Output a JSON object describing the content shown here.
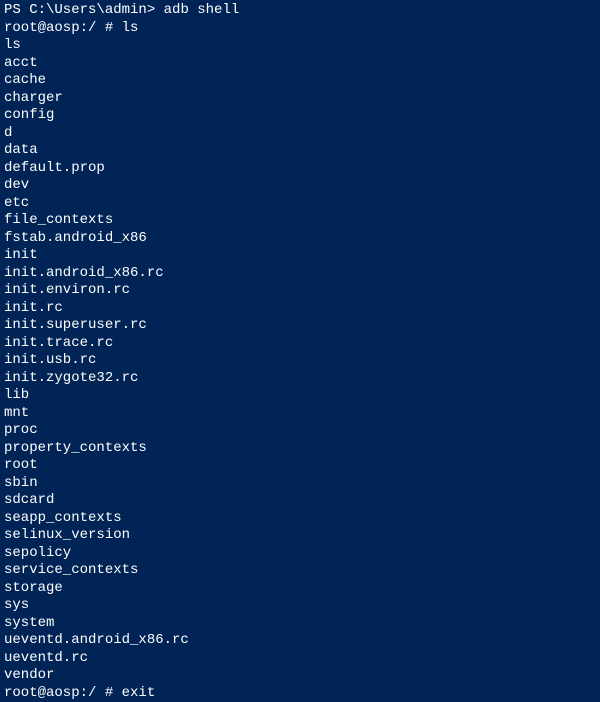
{
  "lines": [
    {
      "type": "prompt-cmd",
      "prompt": "PS C:\\Users\\admin> ",
      "cmd": "adb shell"
    },
    {
      "type": "prompt-cmd",
      "prompt": "root@aosp:/ # ",
      "cmd": "ls"
    },
    {
      "type": "output",
      "text": "ls"
    },
    {
      "type": "output",
      "text": "acct"
    },
    {
      "type": "output",
      "text": "cache"
    },
    {
      "type": "output",
      "text": "charger"
    },
    {
      "type": "output",
      "text": "config"
    },
    {
      "type": "output",
      "text": "d"
    },
    {
      "type": "output",
      "text": "data"
    },
    {
      "type": "output",
      "text": "default.prop"
    },
    {
      "type": "output",
      "text": "dev"
    },
    {
      "type": "output",
      "text": "etc"
    },
    {
      "type": "output",
      "text": "file_contexts"
    },
    {
      "type": "output",
      "text": "fstab.android_x86"
    },
    {
      "type": "output",
      "text": "init"
    },
    {
      "type": "output",
      "text": "init.android_x86.rc"
    },
    {
      "type": "output",
      "text": "init.environ.rc"
    },
    {
      "type": "output",
      "text": "init.rc"
    },
    {
      "type": "output",
      "text": "init.superuser.rc"
    },
    {
      "type": "output",
      "text": "init.trace.rc"
    },
    {
      "type": "output",
      "text": "init.usb.rc"
    },
    {
      "type": "output",
      "text": "init.zygote32.rc"
    },
    {
      "type": "output",
      "text": "lib"
    },
    {
      "type": "output",
      "text": "mnt"
    },
    {
      "type": "output",
      "text": "proc"
    },
    {
      "type": "output",
      "text": "property_contexts"
    },
    {
      "type": "output",
      "text": "root"
    },
    {
      "type": "output",
      "text": "sbin"
    },
    {
      "type": "output",
      "text": "sdcard"
    },
    {
      "type": "output",
      "text": "seapp_contexts"
    },
    {
      "type": "output",
      "text": "selinux_version"
    },
    {
      "type": "output",
      "text": "sepolicy"
    },
    {
      "type": "output",
      "text": "service_contexts"
    },
    {
      "type": "output",
      "text": "storage"
    },
    {
      "type": "output",
      "text": "sys"
    },
    {
      "type": "output",
      "text": "system"
    },
    {
      "type": "output",
      "text": "ueventd.android_x86.rc"
    },
    {
      "type": "output",
      "text": "ueventd.rc"
    },
    {
      "type": "output",
      "text": "vendor"
    },
    {
      "type": "prompt-cmd",
      "prompt": "root@aosp:/ # ",
      "cmd": "exit"
    }
  ]
}
